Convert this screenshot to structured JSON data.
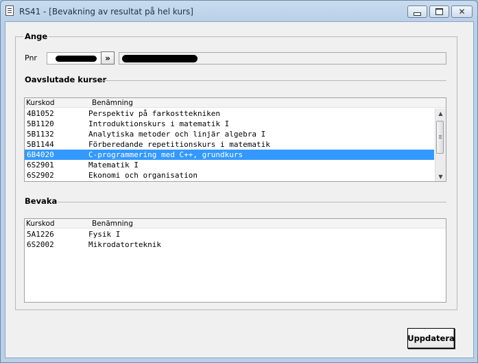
{
  "window": {
    "title": "RS41 - [Bevakning av resultat på hel kurs]",
    "icon": "document-icon"
  },
  "ange": {
    "label": "Ange",
    "pnr_label": "Pnr",
    "pnr_value": "",
    "lookup_button": "»",
    "name_value": ""
  },
  "oavslutade": {
    "label": "Oavslutade kurser",
    "headers": [
      "Kurskod",
      "Benämning"
    ],
    "rows": [
      {
        "code": "4B1052",
        "name": "Perspektiv på farkosttekniken"
      },
      {
        "code": "5B1120",
        "name": "Introduktionskurs i matematik I"
      },
      {
        "code": "5B1132",
        "name": "Analytiska metoder och linjär algebra I"
      },
      {
        "code": "5B1144",
        "name": "Förberedande repetitionskurs i matematik"
      },
      {
        "code": "6B4020",
        "name": "C-programmering med C++, grundkurs"
      },
      {
        "code": "6S2901",
        "name": "Matematik I"
      },
      {
        "code": "6S2902",
        "name": "Ekonomi och organisation"
      }
    ],
    "selected_index": 4
  },
  "bevaka": {
    "label": "Bevaka",
    "headers": [
      "Kurskod",
      "Benämning"
    ],
    "rows": [
      {
        "code": "5A1226",
        "name": "Fysik I"
      },
      {
        "code": "6S2002",
        "name": "Mikrodatorteknik"
      }
    ]
  },
  "actions": {
    "update_label": "Uppdatera"
  },
  "colors": {
    "selection": "#3399ff",
    "title_bar": "#b9d0e8"
  }
}
